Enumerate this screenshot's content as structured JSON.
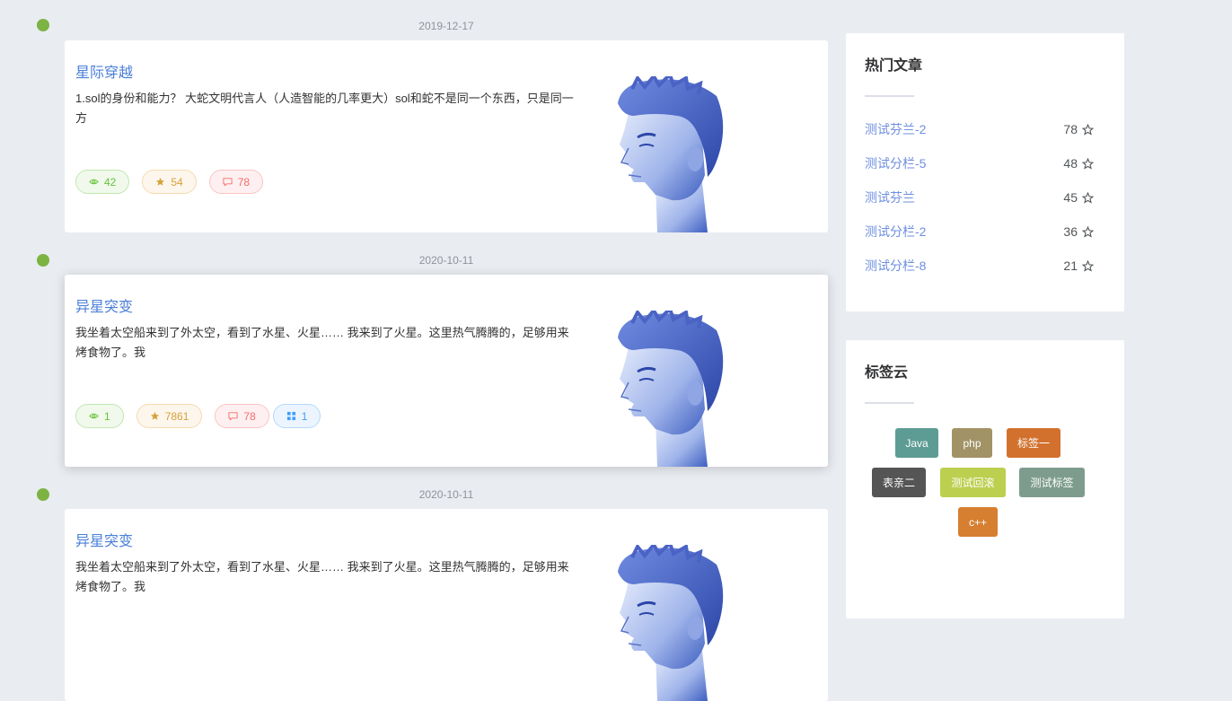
{
  "timeline": {
    "entries": [
      {
        "date": "2019-12-17",
        "title": "星际穿越",
        "summary": "1.sol的身份和能力？ 大蛇文明代言人（人造智能的几率更大）sol和蛇不是同一个东西，只是同一方",
        "views": "42",
        "stars": "54",
        "comments": "78"
      },
      {
        "date": "2020-10-11",
        "title": "异星突变",
        "summary": "我坐着太空船来到了外太空，看到了水星、火星…… 我来到了火星。这里热气腾腾的，足够用来烤食物了。我",
        "views": "1",
        "stars": "7861",
        "comments": "78",
        "category": "1"
      },
      {
        "date": "2020-10-11",
        "title": "异星突变",
        "summary": "我坐着太空船来到了外太空，看到了水星、火星…… 我来到了火星。这里热气腾腾的，足够用来烤食物了。我"
      }
    ]
  },
  "hot_articles": {
    "title": "热门文章",
    "items": [
      {
        "label": "测试芬兰-2",
        "count": "78"
      },
      {
        "label": "测试分栏-5",
        "count": "48"
      },
      {
        "label": "测试芬兰",
        "count": "45"
      },
      {
        "label": "测试分栏-2",
        "count": "36"
      },
      {
        "label": "测试分栏-8",
        "count": "21"
      }
    ]
  },
  "tag_cloud": {
    "title": "标签云",
    "tags": [
      {
        "label": "Java",
        "color": "#5d9c94"
      },
      {
        "label": "php",
        "color": "#a19366"
      },
      {
        "label": "标签一",
        "color": "#d2712e"
      },
      {
        "label": "表亲二",
        "color": "#555555"
      },
      {
        "label": "测试回滚",
        "color": "#bccf4f"
      },
      {
        "label": "测试标签",
        "color": "#7e9c8d"
      },
      {
        "label": "c++",
        "color": "#d67f30"
      }
    ]
  },
  "colors": {
    "dot": "#7cb342",
    "link": "#4a7fd8"
  }
}
